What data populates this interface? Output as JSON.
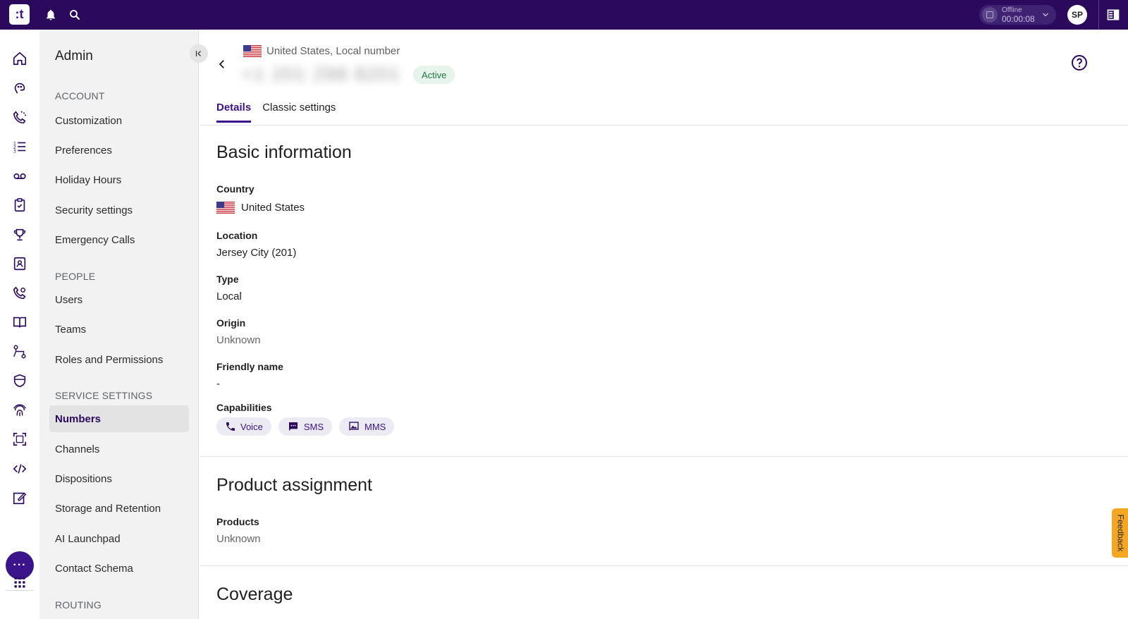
{
  "topbar": {
    "logo_text": ":t",
    "status_label": "Offline",
    "status_time": "00:00:08",
    "avatar_initials": "SP"
  },
  "nav": {
    "title": "Admin",
    "sections": [
      {
        "label": "ACCOUNT",
        "items": [
          "Customization",
          "Preferences",
          "Holiday Hours",
          "Security settings",
          "Emergency Calls"
        ]
      },
      {
        "label": "PEOPLE",
        "items": [
          "Users",
          "Teams",
          "Roles and Permissions"
        ]
      },
      {
        "label": "SERVICE SETTINGS",
        "items": [
          "Numbers",
          "Channels",
          "Dispositions",
          "Storage and Retention",
          "AI Launchpad",
          "Contact Schema"
        ]
      },
      {
        "label": "ROUTING",
        "items": []
      }
    ],
    "active_item": "Numbers"
  },
  "rail": {
    "more_label": "···"
  },
  "header": {
    "subtitle": "United States, Local number",
    "number": "+1 201 298 8201",
    "status_badge": "Active"
  },
  "tabs": [
    "Details",
    "Classic settings"
  ],
  "basic_info": {
    "title": "Basic information",
    "country_label": "Country",
    "country_value": "United States",
    "location_label": "Location",
    "location_value": "Jersey City (201)",
    "type_label": "Type",
    "type_value": "Local",
    "origin_label": "Origin",
    "origin_value": "Unknown",
    "friendly_label": "Friendly name",
    "friendly_value": "-",
    "capabilities_label": "Capabilities",
    "capabilities": [
      "Voice",
      "SMS",
      "MMS"
    ]
  },
  "product_assignment": {
    "title": "Product assignment",
    "products_label": "Products",
    "products_value": "Unknown"
  },
  "coverage": {
    "title": "Coverage"
  },
  "feedback_label": "Feedback",
  "colors": {
    "topbar": "#2b0a5e",
    "accent": "#3b138a",
    "active_badge_bg": "#e6f4ec",
    "active_badge_text": "#1e7a44",
    "feedback": "#f5a623"
  }
}
